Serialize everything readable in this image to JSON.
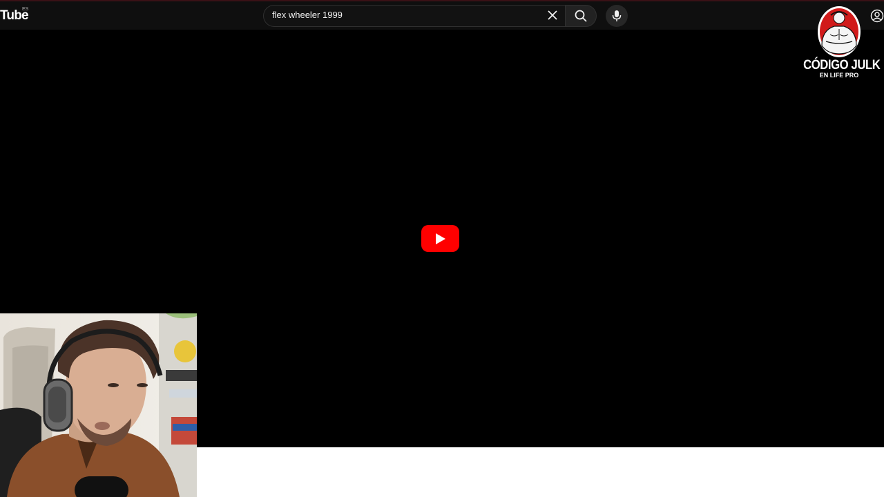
{
  "header": {
    "brand": "Tube",
    "brand_sup": "ES",
    "search": {
      "value": "flex wheeler 1999"
    },
    "icons": [
      "close-icon",
      "search-icon",
      "microphone-icon",
      "account-icon"
    ]
  },
  "player": {
    "play_icon": "youtube-play-icon",
    "play_color": "#ff0000"
  },
  "overlay_logo": {
    "line1": "CÓDIGO JULK",
    "line2": "EN LIFE PRO",
    "accent": "#d11a1a"
  },
  "colors": {
    "topbar": "#0f0f0f",
    "player_bg": "#000000",
    "page_bg": "#ffffff"
  }
}
